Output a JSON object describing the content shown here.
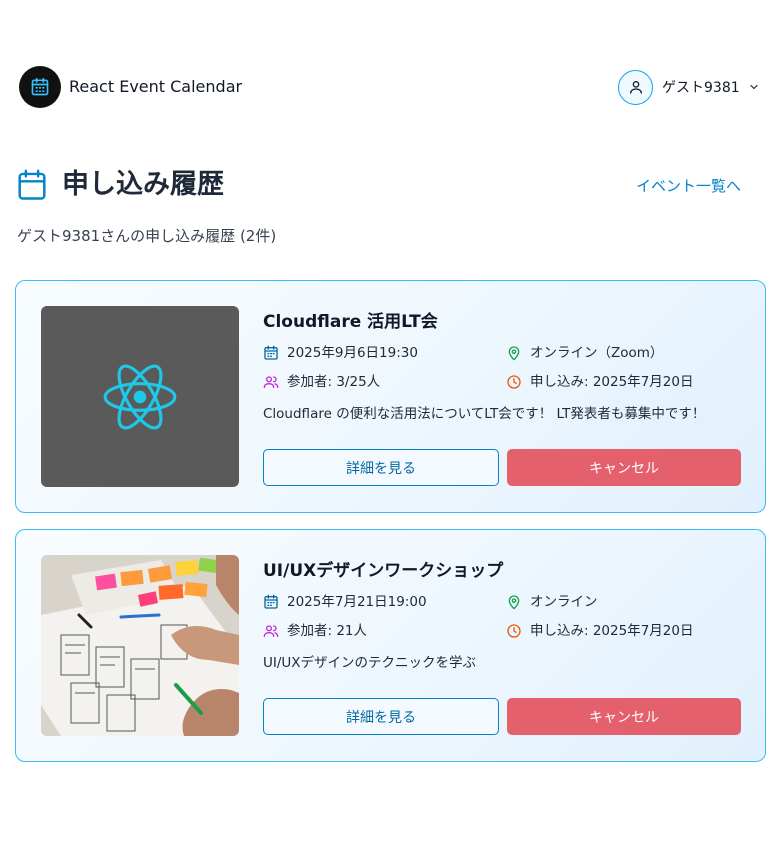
{
  "header": {
    "app_title": "React Event Calendar",
    "logo_icon": "calendar-icon",
    "user_name": "ゲスト9381",
    "user_icon": "user-icon",
    "menu_icon": "chevron-down-icon"
  },
  "page": {
    "title": "申し込み履歴",
    "title_icon": "calendar-icon",
    "back_link": "イベント一覧へ",
    "summary": "ゲスト9381さんの申し込み履歴 (2件)"
  },
  "events": [
    {
      "title": "Cloudflare 活用LT会",
      "thumbnail": "react-logo",
      "datetime": "2025年9月6日19:30",
      "location": "オンライン（Zoom）",
      "participants": "参加者: 3/25人",
      "applied": "申し込み: 2025年7月20日",
      "description": "Cloudflare の便利な活用法についてLT会です！ LT発表者も募集中です！",
      "detail_label": "詳細を見る",
      "cancel_label": "キャンセル"
    },
    {
      "title": "UI/UXデザインワークショップ",
      "thumbnail": "workshop-photo",
      "datetime": "2025年7月21日19:00",
      "location": "オンライン",
      "participants": "参加者: 21人",
      "applied": "申し込み: 2025年7月20日",
      "description": "UI/UXデザインのテクニックを学ぶ",
      "detail_label": "詳細を見る",
      "cancel_label": "キャンセル"
    }
  ],
  "colors": {
    "accent": "#0284c7",
    "card_border": "#38bdf8",
    "cancel": "#e5606d",
    "icon_date": "#0369a1",
    "icon_location": "#16a34a",
    "icon_participants": "#c026d3",
    "icon_applied": "#ea580c"
  }
}
